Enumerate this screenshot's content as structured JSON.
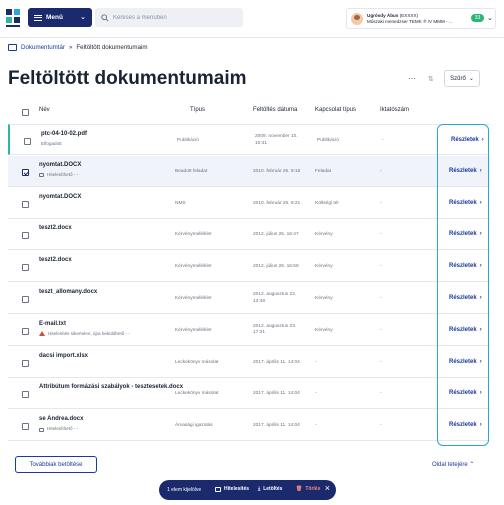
{
  "header": {
    "menu_label": "Menü",
    "search_placeholder": "Keresés a menüben",
    "user_name": "Ugrósdy Ábus",
    "user_id": "(EXXXX)",
    "user_org": "Műszaki menedzser TEMK ® /V MMM - ...",
    "badge": "33"
  },
  "breadcrumb": {
    "root": "Dokumentumtár",
    "current": "Feltöltött dokumentumaim"
  },
  "page": {
    "title": "Feltöltött dokumentumaim",
    "filter_label": "Szűrő"
  },
  "table": {
    "columns": {
      "name": "Név",
      "type": "Típus",
      "date": "Feltöltés dátuma",
      "relation": "Kapcsolat típus",
      "iktatoszam": "Iktatószám"
    },
    "details_label": "Részletek",
    "rows": [
      {
        "name": "ptc-04-10-02.pdf",
        "sub": "Elfogadott",
        "sub_icon": "none",
        "type": "Publikáció",
        "date1": "2009. november 10.",
        "date2": "10:41",
        "relation": "Publikáció",
        "iktatoszam": "-",
        "checked": false
      },
      {
        "name": "nyomtat.DOCX",
        "sub": "Hitelesíthető - -",
        "sub_icon": "lock",
        "type": "Beadott feladat",
        "date1": "2010. február 25. 9:18",
        "date2": "",
        "relation": "Feladat",
        "iktatoszam": "-",
        "checked": true
      },
      {
        "name": "nyomtat.DOCX",
        "sub": "",
        "sub_icon": "none",
        "type": "NMS",
        "date1": "2010. február 25. 9:21",
        "date2": "",
        "relation": "Költségi tér",
        "iktatoszam": "-",
        "checked": false
      },
      {
        "name": "teszt2.docx",
        "sub": "",
        "sub_icon": "none",
        "type": "Kérvénymelléklet",
        "date1": "2012. július 25. 16:47",
        "date2": "",
        "relation": "Kérvény",
        "iktatoszam": "-",
        "checked": false
      },
      {
        "name": "teszt2.docx",
        "sub": "",
        "sub_icon": "none",
        "type": "Kérvénymelléklet",
        "date1": "2012. július 26. 16:58",
        "date2": "",
        "relation": "Kérvény",
        "iktatoszam": "-",
        "checked": false
      },
      {
        "name": "teszt_allomany.docx",
        "sub": "",
        "sub_icon": "none",
        "type": "Kérvénymelléklet",
        "date1": "2012. augusztus 22.",
        "date2": "13:48",
        "relation": "Kérvény",
        "iktatoszam": "-",
        "checked": false
      },
      {
        "name": "E-mail.txt",
        "sub": "Hitelesítés sikertelen, újra beküldhető - -",
        "sub_icon": "warn",
        "type": "Kérvénymelléklet",
        "date1": "2012. augusztus 23.",
        "date2": "17:31",
        "relation": "Kérvény",
        "iktatoszam": "-",
        "checked": false
      },
      {
        "name": "dacsi import.xlsx",
        "sub": "",
        "sub_icon": "none",
        "type": "Leckekönyv másolat",
        "date1": "2017. április 11. 14:04",
        "date2": "",
        "relation": "-",
        "iktatoszam": "-",
        "checked": false
      },
      {
        "name": "Attribútum formázási szabályok - tesztesetek.docx",
        "sub": "",
        "sub_icon": "none",
        "type": "Leckekönyv másolat",
        "date1": "2017. április 11. 14:04",
        "date2": "",
        "relation": "-",
        "iktatoszam": "-",
        "checked": false
      },
      {
        "name": "se Andrea.docx",
        "sub": "Hitelesíthető - -",
        "sub_icon": "lock",
        "type": "Árvasági igazolás",
        "date1": "2017. április 11. 14:04",
        "date2": "",
        "relation": "-",
        "iktatoszam": "-",
        "checked": false
      }
    ]
  },
  "footer": {
    "load_more": "Továbbiak betöltése",
    "top_link": "Oldal tetejére"
  },
  "actionbar": {
    "selected": "1 elem kijelölve",
    "authenticate": "Hitelesítés",
    "download": "Letöltés",
    "delete": "Törlés"
  }
}
